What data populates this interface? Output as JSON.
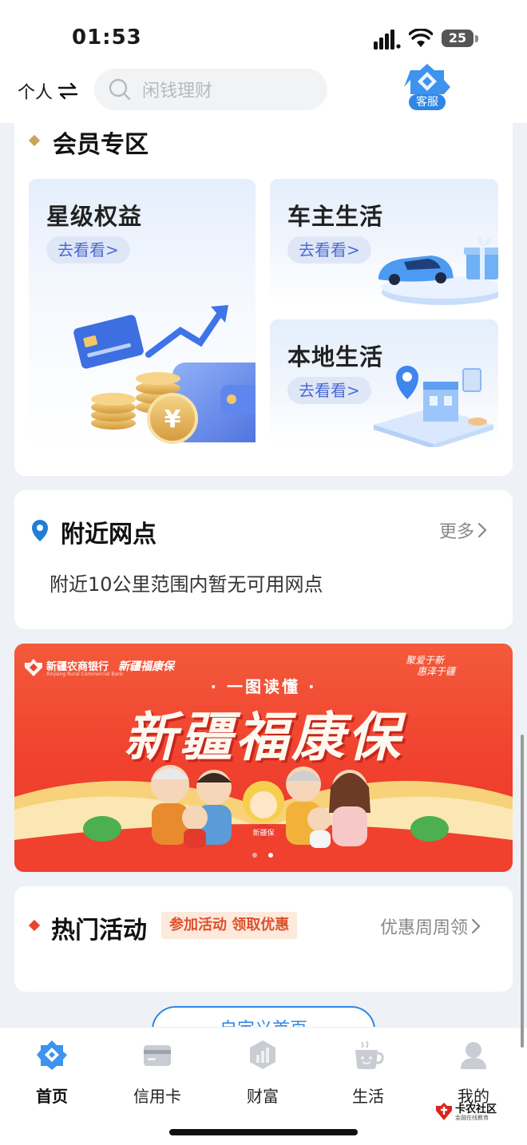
{
  "status_bar": {
    "time": "01:53",
    "battery": "25"
  },
  "top_bar": {
    "personal_label": "个人",
    "search_placeholder": "闲钱理财",
    "service_label": "客服"
  },
  "member_zone": {
    "title": "会员专区",
    "tiles": [
      {
        "title": "星级权益",
        "button": "去看看>"
      },
      {
        "title": "车主生活",
        "button": "去看看>"
      },
      {
        "title": "本地生活",
        "button": "去看看>"
      }
    ]
  },
  "nearby": {
    "title": "附近网点",
    "more": "更多",
    "message": "附近10公里范围内暂无可用网点"
  },
  "banner": {
    "bank_name": "新疆农商银行",
    "bank_name_en": "Xinjiang Rural Commercial Bank",
    "product_logo": "新疆福康保",
    "slogan_line1": "聚爱于新",
    "slogan_line2": "惠泽于疆",
    "subtitle": "· 一图读懂 ·",
    "headline": "新疆福康保",
    "mascot_badge": "新疆保"
  },
  "hot_activities": {
    "title": "热门活动",
    "tag": "参加活动 领取优惠",
    "more": "优惠周周领"
  },
  "partial_button": "自定义首页",
  "tabs": [
    {
      "label": "首页",
      "icon": "home-icon",
      "active": true
    },
    {
      "label": "信用卡",
      "icon": "credit-card-icon",
      "active": false
    },
    {
      "label": "财富",
      "icon": "wealth-icon",
      "active": false
    },
    {
      "label": "生活",
      "icon": "life-icon",
      "active": false
    },
    {
      "label": "我的",
      "icon": "profile-icon",
      "active": false
    }
  ],
  "watermark": {
    "name": "卡农社区",
    "sub": "金融在线教育"
  },
  "colors": {
    "accent": "#2f86e6",
    "gold": "#c8a35a",
    "red_accent": "#e8442e",
    "banner_red": "#f0402e"
  }
}
